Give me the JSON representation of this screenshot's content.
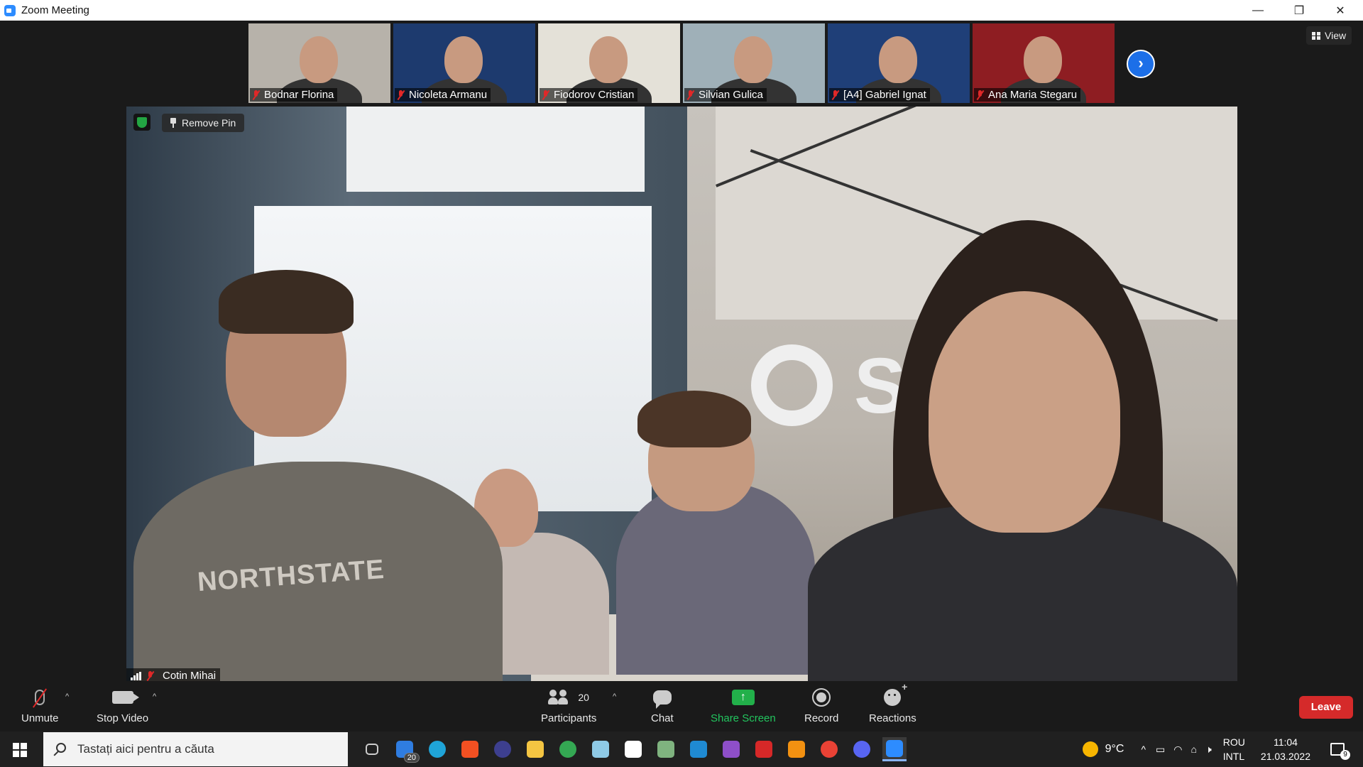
{
  "window": {
    "title": "Zoom Meeting",
    "minimize": "—",
    "restore": "❐",
    "close": "✕"
  },
  "thumbnails": [
    {
      "name": "Bodnar Florina",
      "bg": "#b7b2aa"
    },
    {
      "name": "Nicoleta Armanu",
      "bg": "#1d3a6e"
    },
    {
      "name": "Fiodorov Cristian",
      "bg": "#e4e1d8"
    },
    {
      "name": "Silvian Gulica",
      "bg": "#9fb0b8"
    },
    {
      "name": "[A4]  Gabriel Ignat",
      "bg": "#1f3f78"
    },
    {
      "name": "Ana Maria Stegaru",
      "bg": "#8e1d22"
    }
  ],
  "strip_next_icon": "›",
  "view_button": {
    "label": "View"
  },
  "main_video": {
    "pin_label": "Remove Pin",
    "participant_name": "Cotin Mihai",
    "shirt_text": "NORTHSTATE",
    "logo_letter": "S"
  },
  "toolbar": {
    "unmute": "Unmute",
    "stop_video": "Stop Video",
    "participants": "Participants",
    "participants_count": "20",
    "chat": "Chat",
    "share_screen": "Share Screen",
    "share_arrow": "↑",
    "record": "Record",
    "reactions": "Reactions",
    "leave": "Leave",
    "caret": "^"
  },
  "taskbar": {
    "search_placeholder": "Tastați aici pentru a căuta",
    "mail_badge": "20",
    "weather_temp": "9°C",
    "lang_top": "ROU",
    "lang_bottom": "INTL",
    "time": "11:04",
    "date": "21.03.2022",
    "notif_count": "9",
    "apps": [
      {
        "name": "task-view",
        "color": "#cccccc"
      },
      {
        "name": "mail",
        "color": "#2f7de1"
      },
      {
        "name": "edge",
        "color": "#1fa4d8"
      },
      {
        "name": "store",
        "color": "#f25022"
      },
      {
        "name": "eclipse",
        "color": "#3d3f8f"
      },
      {
        "name": "file-explorer",
        "color": "#f4c542"
      },
      {
        "name": "chrome",
        "color": "#34a853"
      },
      {
        "name": "notepad-plus",
        "color": "#8ecae6"
      },
      {
        "name": "document",
        "color": "#ffffff"
      },
      {
        "name": "database-tool",
        "color": "#7fb37f"
      },
      {
        "name": "vscode",
        "color": "#1f8ad2"
      },
      {
        "name": "visual-studio",
        "color": "#8e4fc9"
      },
      {
        "name": "security-app",
        "color": "#d62828"
      },
      {
        "name": "sublime",
        "color": "#f29111"
      },
      {
        "name": "chrome-profile",
        "color": "#e94235"
      },
      {
        "name": "discord",
        "color": "#5865f2"
      },
      {
        "name": "zoom",
        "color": "#2d8cff"
      }
    ]
  }
}
